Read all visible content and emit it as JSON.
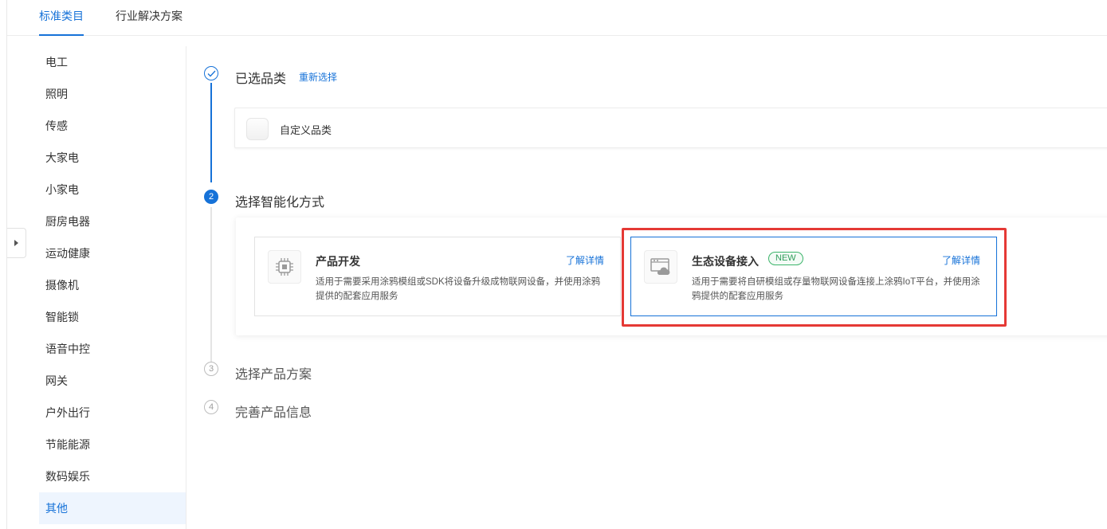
{
  "tabs": [
    {
      "label": "标准类目",
      "active": true
    },
    {
      "label": "行业解决方案",
      "active": false
    }
  ],
  "sidebar": {
    "items": [
      {
        "label": "电工"
      },
      {
        "label": "照明"
      },
      {
        "label": "传感"
      },
      {
        "label": "大家电"
      },
      {
        "label": "小家电"
      },
      {
        "label": "厨房电器"
      },
      {
        "label": "运动健康"
      },
      {
        "label": "摄像机"
      },
      {
        "label": "智能锁"
      },
      {
        "label": "语音中控"
      },
      {
        "label": "网关"
      },
      {
        "label": "户外出行"
      },
      {
        "label": "节能能源"
      },
      {
        "label": "数码娱乐"
      },
      {
        "label": "其他",
        "selected": true
      }
    ]
  },
  "steps": {
    "step1": {
      "title": "已选品类",
      "action": "重新选择",
      "category": "自定义品类"
    },
    "step2": {
      "number": "2",
      "title": "选择智能化方式"
    },
    "step3": {
      "number": "3",
      "title": "选择产品方案"
    },
    "step4": {
      "number": "4",
      "title": "完善产品信息"
    }
  },
  "modes": {
    "product_dev": {
      "title": "产品开发",
      "link": "了解详情",
      "description": "适用于需要采用涂鸦模组或SDK将设备升级成物联网设备，并使用涂鸦提供的配套应用服务",
      "icon": "chip-icon"
    },
    "ecosystem": {
      "title": "生态设备接入",
      "badge": "NEW",
      "link": "了解详情",
      "description": "适用于需要将自研模组或存量物联网设备连接上涂鸦IoT平台，并使用涂鸦提供的配套应用服务",
      "icon": "cloud-window-icon",
      "selected": true
    }
  },
  "colors": {
    "primary": "#1672d8",
    "highlight": "#e53935",
    "badge": "#3bb46a"
  }
}
